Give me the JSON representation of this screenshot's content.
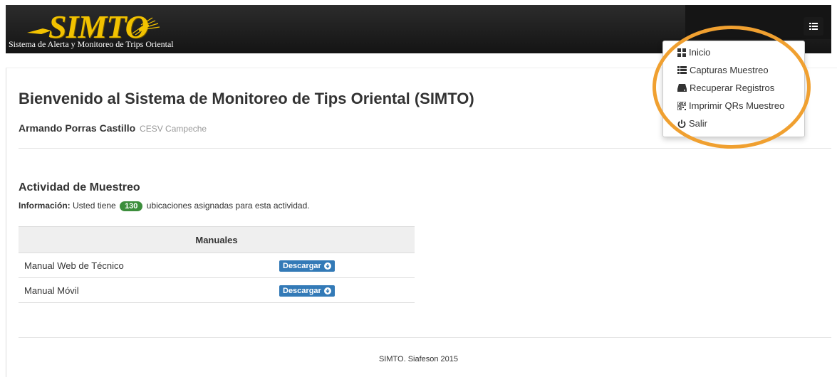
{
  "header": {
    "logo_text": "SIMTO",
    "subtitle": "Sistema de Alerta y Monitoreo de Trips Oriental"
  },
  "menu": {
    "items": [
      {
        "label": "Inicio",
        "icon": "grid-icon"
      },
      {
        "label": "Capturas Muestreo",
        "icon": "list-icon"
      },
      {
        "label": "Recuperar Registros",
        "icon": "hdd-icon"
      },
      {
        "label": "Imprimir QRs Muestreo",
        "icon": "qrcode-icon"
      },
      {
        "label": "Salir",
        "icon": "power-icon"
      }
    ]
  },
  "page": {
    "title": "Bienvenido al Sistema de Monitoreo de Tips Oriental (SIMTO)",
    "user_name": "Armando Porras Castillo",
    "user_org": "CESV Campeche"
  },
  "activity": {
    "title": "Actividad de Muestreo",
    "info_label": "Información:",
    "info_prefix": "Usted tiene",
    "count": "130",
    "info_suffix": "ubicaciones asignadas para esta actividad."
  },
  "manuals": {
    "header": "Manuales",
    "rows": [
      {
        "name": "Manual Web de Técnico",
        "button": "Descargar"
      },
      {
        "name": "Manual Móvil",
        "button": "Descargar"
      }
    ]
  },
  "footer": {
    "text": "SIMTO. Siafeson 2015"
  },
  "colors": {
    "logo_yellow": "#f2c200",
    "badge_green": "#3c8e3c",
    "button_blue": "#337ab7",
    "highlight_orange": "#f0a030"
  }
}
